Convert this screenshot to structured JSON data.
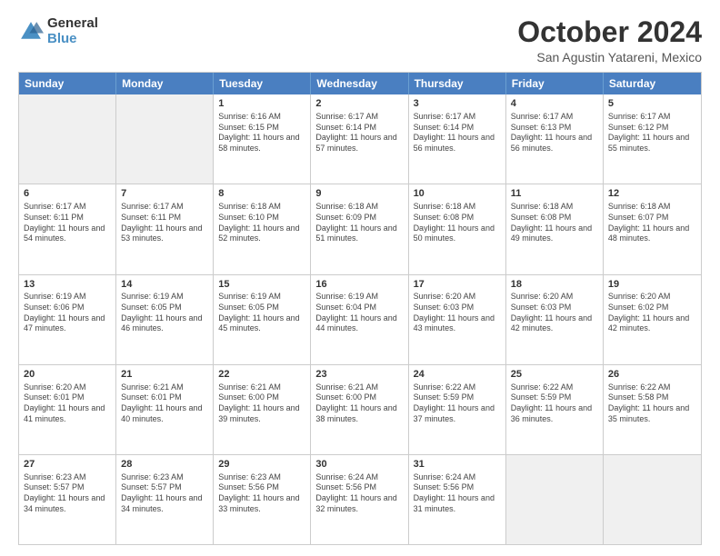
{
  "header": {
    "logo_line1": "General",
    "logo_line2": "Blue",
    "month": "October 2024",
    "location": "San Agustin Yatareni, Mexico"
  },
  "days_of_week": [
    "Sunday",
    "Monday",
    "Tuesday",
    "Wednesday",
    "Thursday",
    "Friday",
    "Saturday"
  ],
  "weeks": [
    [
      {
        "day": "",
        "info": "",
        "shaded": true
      },
      {
        "day": "",
        "info": "",
        "shaded": true
      },
      {
        "day": "1",
        "info": "Sunrise: 6:16 AM\nSunset: 6:15 PM\nDaylight: 11 hours and 58 minutes."
      },
      {
        "day": "2",
        "info": "Sunrise: 6:17 AM\nSunset: 6:14 PM\nDaylight: 11 hours and 57 minutes."
      },
      {
        "day": "3",
        "info": "Sunrise: 6:17 AM\nSunset: 6:14 PM\nDaylight: 11 hours and 56 minutes."
      },
      {
        "day": "4",
        "info": "Sunrise: 6:17 AM\nSunset: 6:13 PM\nDaylight: 11 hours and 56 minutes."
      },
      {
        "day": "5",
        "info": "Sunrise: 6:17 AM\nSunset: 6:12 PM\nDaylight: 11 hours and 55 minutes."
      }
    ],
    [
      {
        "day": "6",
        "info": "Sunrise: 6:17 AM\nSunset: 6:11 PM\nDaylight: 11 hours and 54 minutes."
      },
      {
        "day": "7",
        "info": "Sunrise: 6:17 AM\nSunset: 6:11 PM\nDaylight: 11 hours and 53 minutes."
      },
      {
        "day": "8",
        "info": "Sunrise: 6:18 AM\nSunset: 6:10 PM\nDaylight: 11 hours and 52 minutes."
      },
      {
        "day": "9",
        "info": "Sunrise: 6:18 AM\nSunset: 6:09 PM\nDaylight: 11 hours and 51 minutes."
      },
      {
        "day": "10",
        "info": "Sunrise: 6:18 AM\nSunset: 6:08 PM\nDaylight: 11 hours and 50 minutes."
      },
      {
        "day": "11",
        "info": "Sunrise: 6:18 AM\nSunset: 6:08 PM\nDaylight: 11 hours and 49 minutes."
      },
      {
        "day": "12",
        "info": "Sunrise: 6:18 AM\nSunset: 6:07 PM\nDaylight: 11 hours and 48 minutes."
      }
    ],
    [
      {
        "day": "13",
        "info": "Sunrise: 6:19 AM\nSunset: 6:06 PM\nDaylight: 11 hours and 47 minutes."
      },
      {
        "day": "14",
        "info": "Sunrise: 6:19 AM\nSunset: 6:05 PM\nDaylight: 11 hours and 46 minutes."
      },
      {
        "day": "15",
        "info": "Sunrise: 6:19 AM\nSunset: 6:05 PM\nDaylight: 11 hours and 45 minutes."
      },
      {
        "day": "16",
        "info": "Sunrise: 6:19 AM\nSunset: 6:04 PM\nDaylight: 11 hours and 44 minutes."
      },
      {
        "day": "17",
        "info": "Sunrise: 6:20 AM\nSunset: 6:03 PM\nDaylight: 11 hours and 43 minutes."
      },
      {
        "day": "18",
        "info": "Sunrise: 6:20 AM\nSunset: 6:03 PM\nDaylight: 11 hours and 42 minutes."
      },
      {
        "day": "19",
        "info": "Sunrise: 6:20 AM\nSunset: 6:02 PM\nDaylight: 11 hours and 42 minutes."
      }
    ],
    [
      {
        "day": "20",
        "info": "Sunrise: 6:20 AM\nSunset: 6:01 PM\nDaylight: 11 hours and 41 minutes."
      },
      {
        "day": "21",
        "info": "Sunrise: 6:21 AM\nSunset: 6:01 PM\nDaylight: 11 hours and 40 minutes."
      },
      {
        "day": "22",
        "info": "Sunrise: 6:21 AM\nSunset: 6:00 PM\nDaylight: 11 hours and 39 minutes."
      },
      {
        "day": "23",
        "info": "Sunrise: 6:21 AM\nSunset: 6:00 PM\nDaylight: 11 hours and 38 minutes."
      },
      {
        "day": "24",
        "info": "Sunrise: 6:22 AM\nSunset: 5:59 PM\nDaylight: 11 hours and 37 minutes."
      },
      {
        "day": "25",
        "info": "Sunrise: 6:22 AM\nSunset: 5:59 PM\nDaylight: 11 hours and 36 minutes."
      },
      {
        "day": "26",
        "info": "Sunrise: 6:22 AM\nSunset: 5:58 PM\nDaylight: 11 hours and 35 minutes."
      }
    ],
    [
      {
        "day": "27",
        "info": "Sunrise: 6:23 AM\nSunset: 5:57 PM\nDaylight: 11 hours and 34 minutes."
      },
      {
        "day": "28",
        "info": "Sunrise: 6:23 AM\nSunset: 5:57 PM\nDaylight: 11 hours and 34 minutes."
      },
      {
        "day": "29",
        "info": "Sunrise: 6:23 AM\nSunset: 5:56 PM\nDaylight: 11 hours and 33 minutes."
      },
      {
        "day": "30",
        "info": "Sunrise: 6:24 AM\nSunset: 5:56 PM\nDaylight: 11 hours and 32 minutes."
      },
      {
        "day": "31",
        "info": "Sunrise: 6:24 AM\nSunset: 5:56 PM\nDaylight: 11 hours and 31 minutes."
      },
      {
        "day": "",
        "info": "",
        "shaded": true
      },
      {
        "day": "",
        "info": "",
        "shaded": true
      }
    ]
  ]
}
